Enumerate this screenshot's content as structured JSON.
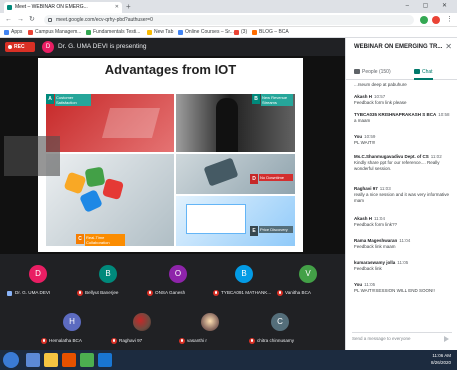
{
  "browser": {
    "tab_title": "Meet – WEBINAR ON EMERG...",
    "new_tab": "+",
    "window_controls": "– ▢ ✕",
    "url": "meet.google.com/ecv-qrhy-pbd?authuser=0",
    "bookmarks": [
      {
        "label": "Apps",
        "color": "#4285f4"
      },
      {
        "label": "Campus Managem...",
        "color": "#ea4335"
      },
      {
        "label": "Fundamentals Testi...",
        "color": "#34a853"
      },
      {
        "label": "New Tab",
        "color": "#fbbc04"
      },
      {
        "label": "Online Courses – Sr...",
        "color": "#4285f4"
      },
      {
        "label": "(3)",
        "color": "#ea4335"
      },
      {
        "label": "BLOG – BCA",
        "color": "#ff6d00"
      }
    ]
  },
  "meet": {
    "rec_label": "REC",
    "presenter_initial": "D",
    "presenting_text": "Dr. G. UMA DEVI is presenting"
  },
  "slide": {
    "title": "Advantages from IOT",
    "labels": {
      "a": "Customer Satisfaction",
      "b": "New Revenue Streams",
      "c": "Real-Time Collaboration",
      "d": "No Downtime",
      "e": "Price Discovery"
    },
    "letters": [
      "A",
      "B",
      "C",
      "D",
      "E"
    ]
  },
  "participants": [
    {
      "initial": "D",
      "name": "Dr. G. UMA DEVI",
      "color": "#e91e63",
      "pinned": true
    },
    {
      "initial": "B",
      "name": "Bellyut Banerjee",
      "color": "#00897b",
      "pinned": false
    },
    {
      "initial": "O",
      "name": "ONSA Ganesh",
      "color": "#8e24aa",
      "pinned": false
    },
    {
      "initial": "B",
      "name": "TYBCA091 MATHANK...",
      "color": "#039be5",
      "pinned": false
    },
    {
      "initial": "V",
      "name": "Vanitha BCA",
      "color": "#43a047",
      "pinned": false
    },
    {
      "initial": "H",
      "name": "Hemalatha BCA",
      "color": "#5c6bc0",
      "pinned": false
    },
    {
      "initial": "",
      "name": "Raghavi 97",
      "color": "#a1887f",
      "pinned": false
    },
    {
      "initial": "",
      "name": "vasanthi r",
      "color": "#bcaaa4",
      "pinned": false
    },
    {
      "initial": "C",
      "name": "chitra chinnusamy",
      "color": "#546e7a",
      "pinned": false
    }
  ],
  "panel": {
    "title": "WEBINAR ON EMERGING TR...",
    "close": "✕",
    "tab_people": "People (150)",
    "tab_chat": "Chat",
    "messages": [
      {
        "sender": "",
        "time": "",
        "text": "...rseum deep at pabuhure"
      },
      {
        "sender": "Akash H",
        "time": "10:57",
        "text": "Feedback form link please"
      },
      {
        "sender": "TYBCA035 KRISHNAPRAKASH S BCA",
        "time": "10:58",
        "text": "a maam"
      },
      {
        "sender": "You",
        "time": "10:59",
        "text": "PL WAIT!!!"
      },
      {
        "sender": "Ms.C.Shanmugavadivu Dept. of CS",
        "time": "11:02",
        "text": "Kindly share ppt for our reference.... Really wonderful session."
      },
      {
        "sender": "Raghavi 97",
        "time": "11:03",
        "text": "really a nice session and it was very informative mam"
      },
      {
        "sender": "Akash H",
        "time": "11:04",
        "text": "Feedback form link??"
      },
      {
        "sender": "Rama Mageshwaran",
        "time": "11:04",
        "text": "Feedback link maam"
      },
      {
        "sender": "kumaraswamy jolla",
        "time": "11:05",
        "text": "Feedback link"
      },
      {
        "sender": "You",
        "time": "11:05",
        "text": "PL WAIT!!!SESSION WILL END SOON!!"
      }
    ],
    "input_placeholder": "Send a message to everyone"
  },
  "taskbar": {
    "time": "11:06 AM",
    "date": "8/26/2020"
  }
}
